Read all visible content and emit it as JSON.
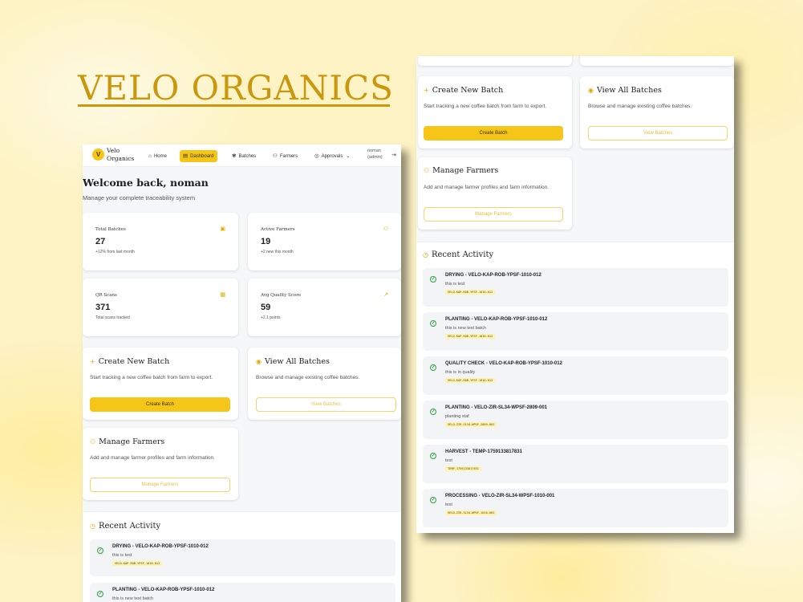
{
  "brand": {
    "title": "VELO ORGANICS"
  },
  "app": {
    "logo_letter": "V",
    "logo_name": "Velo Organics",
    "nav": [
      {
        "label": "Home",
        "icon": "home-icon",
        "active": false
      },
      {
        "label": "Dashboard",
        "icon": "dashboard-icon",
        "active": true
      },
      {
        "label": "Batches",
        "icon": "sprout-icon",
        "active": false
      },
      {
        "label": "Farmers",
        "icon": "users-icon",
        "active": false
      },
      {
        "label": "Approvals",
        "icon": "check-circle-icon",
        "active": false
      }
    ],
    "user_name": "noman",
    "user_role": "(admin)"
  },
  "welcome": {
    "title": "Welcome back, noman",
    "subtitle": "Manage your complete traceability system"
  },
  "stats": [
    {
      "label": "Total Batches",
      "value": "27",
      "sub": "+12% from last month",
      "icon": "package-icon"
    },
    {
      "label": "Active Farmers",
      "value": "19",
      "sub": "+2 new this month",
      "icon": "users-icon"
    },
    {
      "label": "QR Scans",
      "value": "371",
      "sub": "Total scans tracked",
      "icon": "qr-icon"
    },
    {
      "label": "Avg Quality Score",
      "value": "59",
      "sub": "+2.1 points",
      "icon": "trend-icon"
    }
  ],
  "actions": {
    "create": {
      "title": "Create New Batch",
      "desc": "Start tracking a new coffee batch from farm to export.",
      "button": "Create Batch"
    },
    "view": {
      "title": "View All Batches",
      "desc": "Browse and manage existing coffee batches.",
      "button": "View Batches"
    },
    "farmers": {
      "title": "Manage Farmers",
      "desc": "Add and manage farmer profiles and farm information.",
      "button": "Manage Farmers"
    }
  },
  "recent": {
    "title": "Recent Activity",
    "items": [
      {
        "title": "DRYING - VELO-KAP-ROB-YPSF-1010-012",
        "desc": "this is test",
        "code": "VELO-KAP-ROB-YPSF-1010-012"
      },
      {
        "title": "PLANTING - VELO-KAP-ROB-YPSF-1010-012",
        "desc": "this is new test batch",
        "code": "VELO-KAP-ROB-YPSF-1010-012"
      },
      {
        "title": "QUALITY CHECK - VELO-KAP-ROB-YPSF-1010-012",
        "desc": "this is in quality",
        "code": "VELO-KAP-ROB-YPSF-1010-012"
      },
      {
        "title": "PLANTING - VELO-ZIR-SL34-WPSF-2809-001",
        "desc": "planting staf",
        "code": "VELO-ZIR-SL34-WPSF-2809-001"
      },
      {
        "title": "HARVEST - TEMP-1759133817831",
        "desc": "test",
        "code": "TEMP-1759133817831"
      },
      {
        "title": "PROCESSING - VELO-ZIR-SL34-WPSF-1010-001",
        "desc": "test",
        "code": "VELO-ZIR-SL34-WPSF-1010-001"
      }
    ]
  }
}
